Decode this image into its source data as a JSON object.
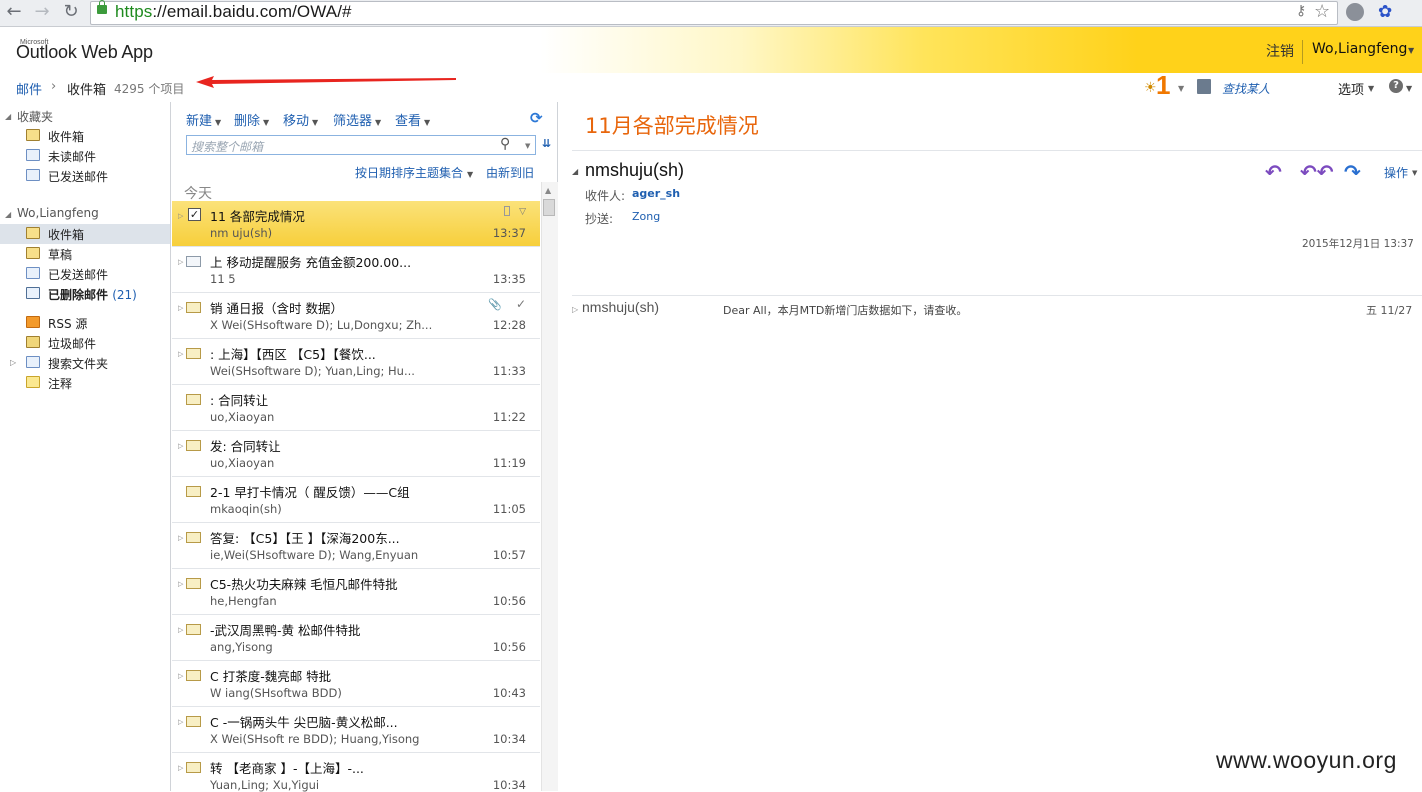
{
  "browser": {
    "url_scheme": "https",
    "url_rest": "://email.baidu.com/OWA/#"
  },
  "header": {
    "brand_small": "Microsoft",
    "app_title": "Outlook Web App",
    "sign_out": "注销",
    "user_name": "Wo,Liangfeng"
  },
  "breadcrumb": {
    "mail": "邮件",
    "separator": "›",
    "folder": "收件箱",
    "count": "4295 个项目"
  },
  "topbar": {
    "reminder_count": "1",
    "find_someone": "查找某人",
    "options": "选项"
  },
  "nav": {
    "favorites_label": "收藏夹",
    "favorites": [
      {
        "label": "收件箱",
        "icon": "inbox-folder-icon"
      },
      {
        "label": "未读邮件",
        "icon": "search-folder-icon"
      },
      {
        "label": "已发送邮件",
        "icon": "sent-folder-icon"
      }
    ],
    "mailbox_label": "Wo,Liangfeng",
    "folders": [
      {
        "label": "收件箱",
        "icon": "inbox-folder-icon"
      },
      {
        "label": "草稿",
        "icon": "drafts-folder-icon"
      },
      {
        "label": "已发送邮件",
        "icon": "sent-folder-icon"
      },
      {
        "label": "已删除邮件",
        "count": "(21)",
        "icon": "deleted-folder-icon"
      },
      {
        "label": "RSS 源",
        "icon": "rss-folder-icon"
      },
      {
        "label": "垃圾邮件",
        "icon": "junk-folder-icon"
      },
      {
        "label": "搜索文件夹",
        "icon": "search-folder-icon"
      },
      {
        "label": "注释",
        "icon": "notes-folder-icon"
      }
    ]
  },
  "toolbar": {
    "new": "新建",
    "delete": "删除",
    "move": "移动",
    "filter": "筛选器",
    "view": "查看"
  },
  "search": {
    "placeholder": "搜索整个邮箱"
  },
  "list": {
    "sort_by": "按日期排序主题集合",
    "sort_order": "由新到旧",
    "group_today": "今天",
    "messages": [
      {
        "subject": "11 各部完成情况",
        "from": "nm  uju(sh)",
        "time": "13:37"
      },
      {
        "subject": "上  移动提醒服务  充值金额200.00...",
        "from": "11  5",
        "time": "13:35"
      },
      {
        "subject": "销  通日报（含时  数据）",
        "from": "X  Wei(SHsoftware  D); Lu,Dongxu; Zh...",
        "time": "12:28"
      },
      {
        "subject": "  : 上海】【西区  【C5】【餐饮...",
        "from": "  Wei(SHsoftware  D); Yuan,Ling; Hu...",
        "time": "11:33"
      },
      {
        "subject": "  : 合同转让",
        "from": "  uo,Xiaoyan",
        "time": "11:22"
      },
      {
        "subject": "  发: 合同转让",
        "from": "  uo,Xiaoyan",
        "time": "11:19"
      },
      {
        "subject": "  2-1 早打卡情况（  醒反馈）——C组",
        "from": "  mkaoqin(sh)",
        "time": "11:05"
      },
      {
        "subject": "答复: 【C5】【王  】【深海200东...",
        "from": "  ie,Wei(SHsoftware  D); Wang,Enyuan",
        "time": "10:57"
      },
      {
        "subject": "C5-热火功夫麻辣  毛恒凡邮件特批",
        "from": "  he,Hengfan",
        "time": "10:56"
      },
      {
        "subject": "  -武汉周黑鸭-黄  松邮件特批",
        "from": "  ang,Yisong",
        "time": "10:56"
      },
      {
        "subject": "C  打茶度-魏亮邮  特批",
        "from": "W  iang(SHsoftwa  BDD)",
        "time": "10:43"
      },
      {
        "subject": "C  -一锅两头牛  尖巴脑-黄义松邮...",
        "from": "X  Wei(SHsoft  re BDD); Huang,Yisong",
        "time": "10:34"
      },
      {
        "subject": "转  【老商家  】-【上海】-...",
        "from": "Yuan,Ling; Xu,Yigui",
        "time": "10:34"
      }
    ]
  },
  "reading": {
    "title": "11月各部完成情况",
    "sender": "nmshuju(sh)",
    "to_label": "收件人:",
    "to_value": "  ager_sh",
    "cc_label": "抄送:",
    "cc_value": "Zong",
    "actions": "操作",
    "sent_time": "2015年12月1日 13:37",
    "conversation": {
      "sender": "nmshuju(sh)",
      "preview": "Dear All，本月MTD新增门店数据如下，请查收。",
      "date": "五 11/27"
    }
  },
  "watermark": "www.wooyun.org",
  "colors": {
    "accent_orange": "#e8660c",
    "link_blue": "#1f5fb0",
    "selected_row": "#f7cf3b"
  }
}
